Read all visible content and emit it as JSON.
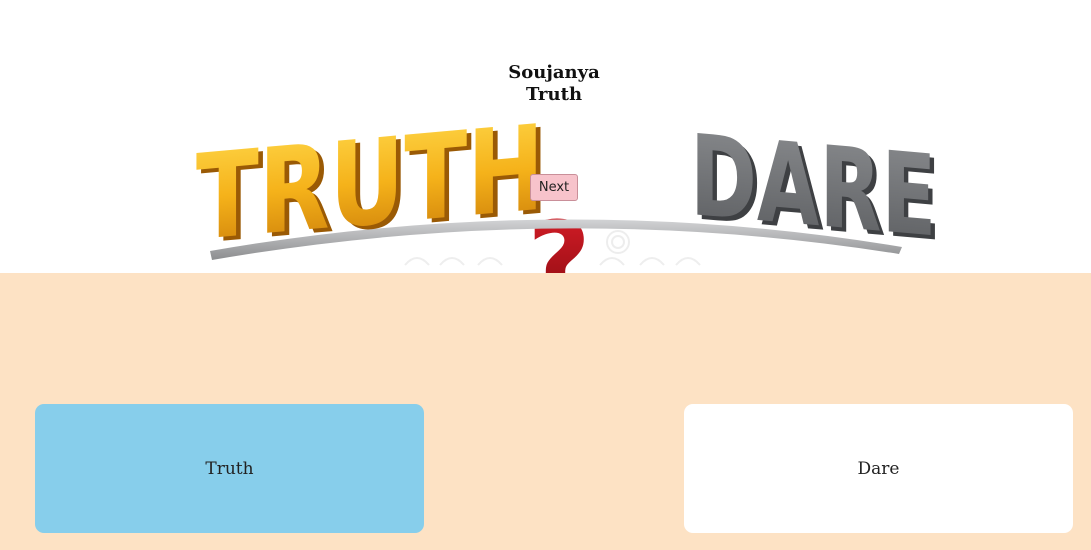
{
  "hero": {
    "player_name": "Soujanya",
    "selected_mode": "Truth",
    "next_label": "Next",
    "art": {
      "left_word": "TRUTH",
      "right_word": "DARE",
      "center_glyph": "?",
      "colors": {
        "truth_face": "#f5b21a",
        "dare_face": "#6e7073",
        "beam": "#a8a9ab",
        "question": "#c0141c"
      }
    }
  },
  "choices": {
    "truth_label": "Truth",
    "dare_label": "Dare",
    "truth_color": "#87ceeb",
    "dare_color": "#ffffff"
  },
  "page": {
    "panel_color": "#fde2c4"
  }
}
